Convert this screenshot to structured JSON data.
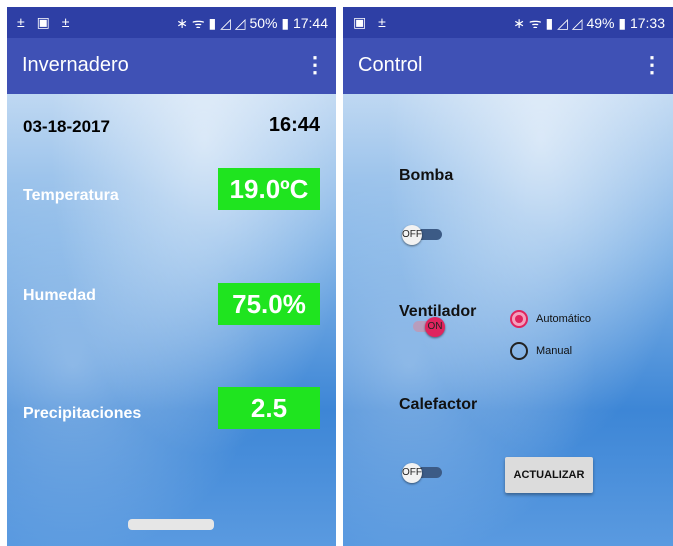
{
  "left": {
    "statusbar": {
      "left_icons": "± ▣ ±",
      "right": "∗ ᯤ ▮ ◿ ◿  50% ▮ 17:44"
    },
    "appbar": {
      "title": "Invernadero",
      "menu_icon": "⋮"
    },
    "date": "03-18-2017",
    "time": "16:44",
    "rows": [
      {
        "label": "Temperatura",
        "value": "19.0ºC"
      },
      {
        "label": "Humedad",
        "value": "75.0%"
      },
      {
        "label": "Precipitaciones",
        "value": "2.5"
      }
    ],
    "value_bg": "#1fe41f"
  },
  "right": {
    "statusbar": {
      "left_icons": "▣ ±",
      "right": "∗ ᯤ ▮ ◿ ◿  49% ▮ 17:33"
    },
    "appbar": {
      "title": "Control",
      "menu_icon": "⋮"
    },
    "bomba": {
      "label": "Bomba",
      "switch_text": "OFF",
      "state": "off"
    },
    "ventilador": {
      "label": "Ventilador",
      "switch_text": "ON",
      "state": "on"
    },
    "mode": {
      "options": [
        "Automático",
        "Manual"
      ],
      "selected": "Automático"
    },
    "calefactor": {
      "label": "Calefactor",
      "switch_text": "OFF",
      "state": "off"
    },
    "update_button": "ACTUALIZAR"
  },
  "colors": {
    "statusbar": "#2e3fa5",
    "appbar": "#3f51b5",
    "accent": "#e0245e"
  }
}
